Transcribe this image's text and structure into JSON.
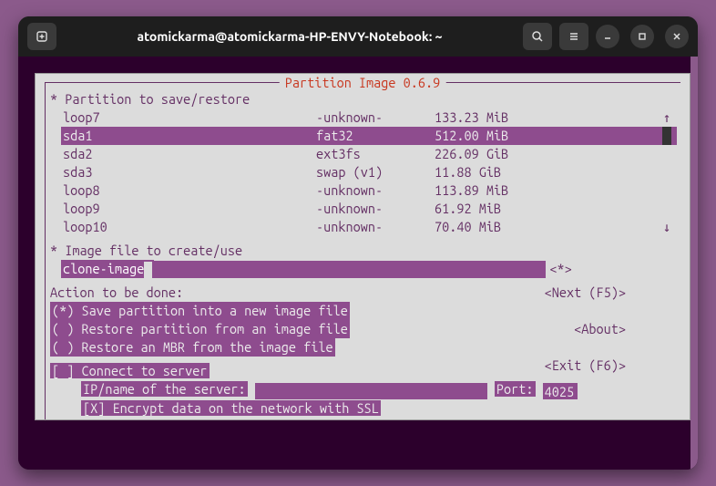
{
  "titlebar": {
    "title": "atomickarma@atomickarma-HP-ENVY-Notebook: ~"
  },
  "dialog": {
    "title": "Partition Image 0.6.9",
    "partition_header": "* Partition to save/restore",
    "partitions": [
      {
        "name": "loop7",
        "type": "-unknown-",
        "size": "133.23 MiB",
        "selected": false
      },
      {
        "name": "sda1",
        "type": "fat32",
        "size": "512.00 MiB",
        "selected": true
      },
      {
        "name": "sda2",
        "type": "ext3fs",
        "size": "226.09 GiB",
        "selected": false
      },
      {
        "name": "sda3",
        "type": "swap (v1)",
        "size": "11.88 GiB",
        "selected": false
      },
      {
        "name": "loop8",
        "type": "-unknown-",
        "size": "113.89 MiB",
        "selected": false
      },
      {
        "name": "loop9",
        "type": "-unknown-",
        "size": "61.92 MiB",
        "selected": false
      },
      {
        "name": "loop10",
        "type": "-unknown-",
        "size": "70.40 MiB",
        "selected": false
      }
    ],
    "image_header": "* Image file to create/use",
    "image_value": "clone-image",
    "image_marker": "<*>",
    "action_header": "Action to be done:",
    "actions": [
      {
        "mark": "(*)",
        "label": "Save partition into a new image file"
      },
      {
        "mark": "( )",
        "label": "Restore partition from an image file"
      },
      {
        "mark": "( )",
        "label": "Restore an MBR from the image file"
      }
    ],
    "nav": {
      "next": "<Next (F5)>",
      "about": "<About>",
      "exit": "<Exit (F6)>"
    },
    "connect_label": "[ ] Connect to server",
    "server_label": "IP/name of the server:",
    "port_label": "Port:",
    "port_value": "4025",
    "ssl_label": "[X] Encrypt data on the network with SSL"
  }
}
